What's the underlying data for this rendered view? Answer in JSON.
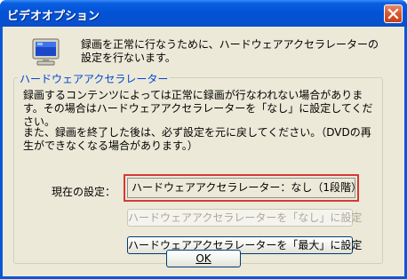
{
  "window": {
    "title": "ビデオオプション"
  },
  "intro": {
    "text": "録画を正常に行なうために、ハードウェアアクセラレーターの設定を行ないます。"
  },
  "group": {
    "legend": "ハードウェアアクセラレーター",
    "paragraph1": "録画するコンテンツによっては正常に録画が行なわれない場合があります。その場合はハードウェアアクセラレーターを「なし」に設定してください。",
    "paragraph2": "また、録画を終了した後は、必ず設定を元に戻してください。（DVDの再生ができなくなる場合があります。）",
    "current_label": "現在の設定：",
    "current_value": "ハードウェアアクセラレーター：なし（1段階）",
    "set_none_label": "ハードウェアアクセラレーターを「なし」に設定",
    "set_max_label": "ハードウェアアクセラレーターを「最大」に設定"
  },
  "footer": {
    "ok_label": "OK"
  },
  "colors": {
    "titlebar": "#0353d6",
    "dialog_bg": "#ece9d8",
    "legend_text": "#0046d5",
    "highlight_border": "#d43a35",
    "close_button": "#d9582e"
  },
  "icons": {
    "app": "monitor-icon",
    "close": "close-icon"
  }
}
